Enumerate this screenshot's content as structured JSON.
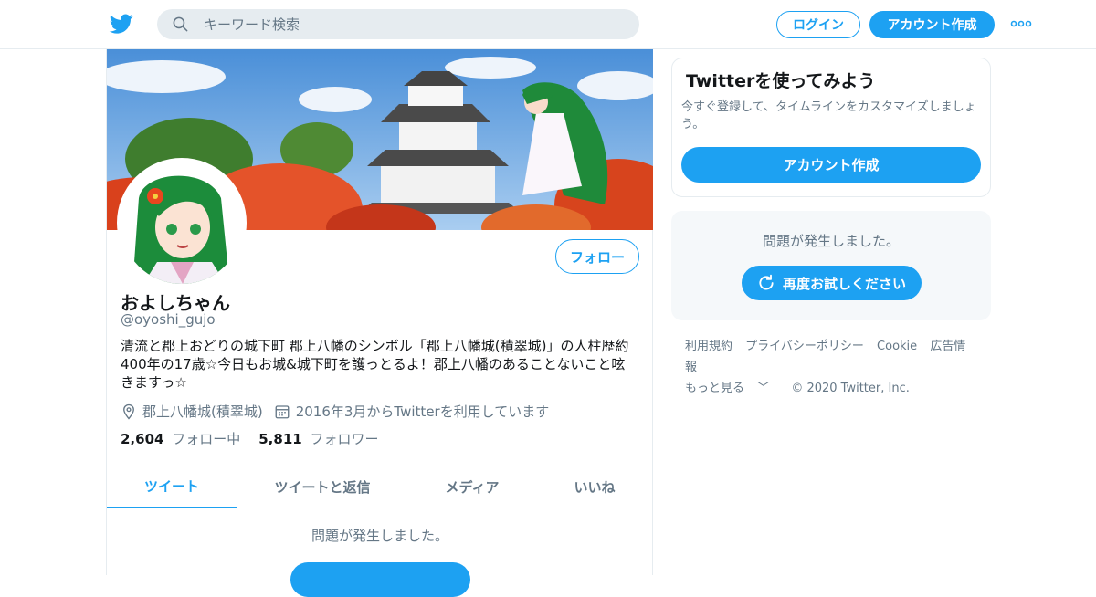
{
  "header": {
    "search_placeholder": "キーワード検索",
    "login_label": "ログイン",
    "signup_label": "アカウント作成"
  },
  "profile": {
    "name": "およしちゃん",
    "handle": "@oyoshi_gujo",
    "bio": "清流と郡上おどりの城下町 郡上八幡のシンボル「郡上八幡城(積翠城)」の人柱歴約400年の17歳☆今日もお城&城下町を護っとるよ！郡上八幡のあることないこと呟きますっ☆",
    "location": "郡上八幡城(積翠城)",
    "joined": "2016年3月からTwitterを利用しています",
    "following_count": "2,604",
    "following_label": "フォロー中",
    "followers_count": "5,811",
    "followers_label": "フォロワー",
    "follow_label": "フォロー"
  },
  "tabs": [
    {
      "label": "ツイート"
    },
    {
      "label": "ツイートと返信"
    },
    {
      "label": "メディア"
    },
    {
      "label": "いいね"
    }
  ],
  "main_error": "問題が発生しました。",
  "signup_card": {
    "title": "Twitterを使ってみよう",
    "text": "今すぐ登録して、タイムラインをカスタマイズしましょう。",
    "cta_label": "アカウント作成"
  },
  "error_card": {
    "message": "問題が発生しました。",
    "retry_label": "再度お試しください"
  },
  "footer": {
    "terms": "利用規約",
    "privacy": "プライバシーポリシー",
    "cookie": "Cookie",
    "ads": "広告情報",
    "more": "もっと見る",
    "copyright": "© 2020 Twitter, Inc."
  },
  "colors": {
    "accent": "#1da1f2",
    "muted": "#657786"
  }
}
